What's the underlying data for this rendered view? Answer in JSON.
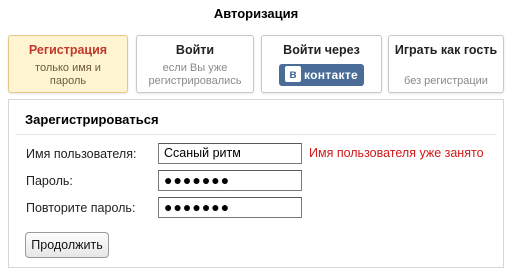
{
  "header": {
    "title": "Авторизация"
  },
  "tabs": [
    {
      "title": "Регистрация",
      "subtitle_1": "только имя и",
      "subtitle_2": "пароль"
    },
    {
      "title": "Войти",
      "subtitle_1": "если Вы уже",
      "subtitle_2": "регистрировались"
    },
    {
      "title": "Войти через",
      "logo_text": "контакте",
      "logo_letter": "в"
    },
    {
      "title": "Играть как гость",
      "subtitle_1": "без регистрации"
    }
  ],
  "form": {
    "heading": "Зарегистрироваться",
    "username_label": "Имя пользователя:",
    "username_value": "Ссаный ритм",
    "username_error": "Имя пользователя уже занято",
    "password_label": "Пароль:",
    "password_value": "●●●●●●●",
    "password_repeat_label": "Повторите пароль:",
    "password_repeat_value": "●●●●●●●",
    "submit_label": "Продолжить"
  },
  "colors": {
    "active_tab_bg": "#fff4d2",
    "active_tab_title": "#c0392b",
    "error": "#d01818",
    "vk_brand": "#4a6d98"
  }
}
